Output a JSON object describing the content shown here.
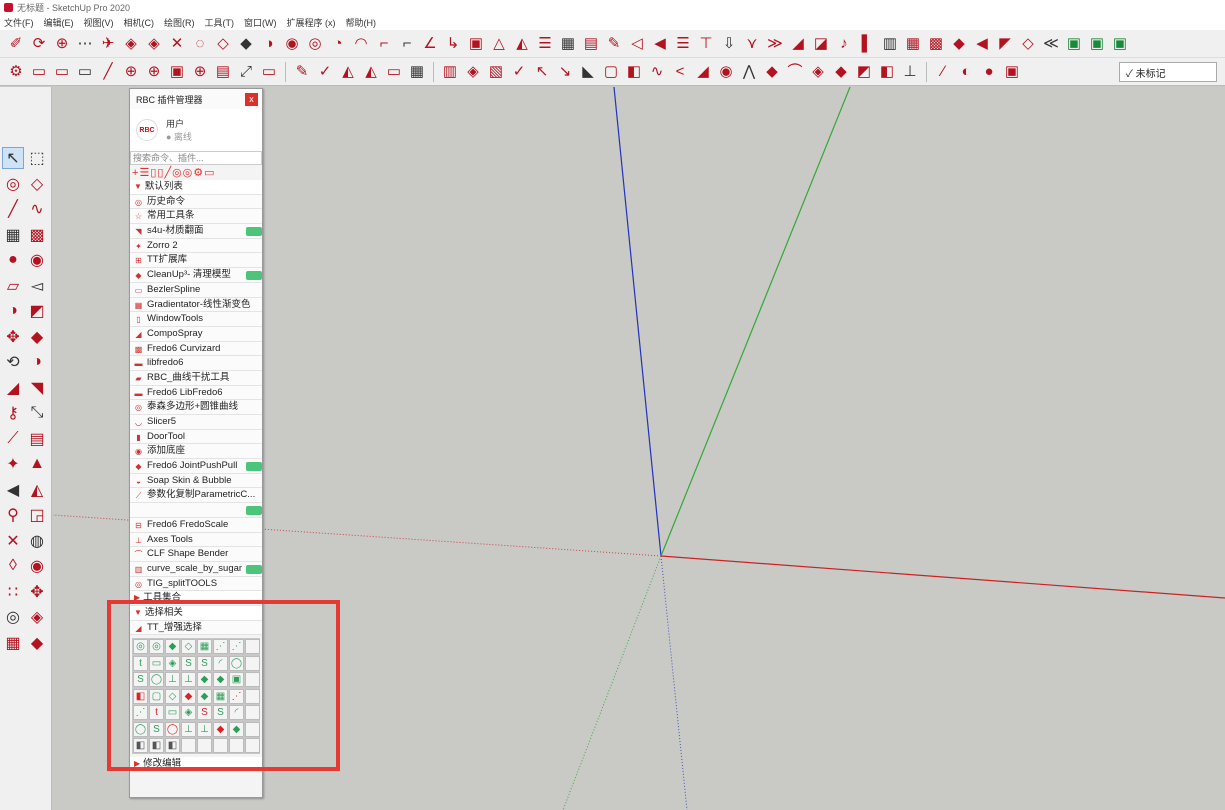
{
  "window": {
    "title": "无标题 - SketchUp Pro 2020"
  },
  "menu": [
    "文件(F)",
    "编辑(E)",
    "视图(V)",
    "相机(C)",
    "绘图(R)",
    "工具(T)",
    "窗口(W)",
    "扩展程序 (x)",
    "帮助(H)"
  ],
  "toolbar1_icons": [
    "✐",
    "⟳",
    "⊕",
    "⋯",
    "✈",
    "◈",
    "◈",
    "✕",
    "◌",
    "◇",
    "◆",
    "◑",
    "◉",
    "◎",
    "◔",
    "◠",
    "⌐",
    "⌐",
    "∠",
    "↳",
    "▣",
    "△",
    "◭",
    "☰",
    "▦",
    "▤",
    "✎",
    "◁",
    "◀",
    "☰",
    "⊤",
    "⇩",
    "⋎",
    "≫",
    "◢",
    "◪",
    "♪",
    "▌",
    "▥",
    "▦",
    "▩",
    "◆",
    "◀",
    "◤",
    "◇",
    "≪",
    "▣",
    "▣",
    "▣"
  ],
  "toolbar2_icons": [
    "⚙",
    "▭",
    "▭",
    "▭",
    "╱",
    "⊕",
    "⊕",
    "▣",
    "⊕",
    "▤",
    "⤢",
    "▭",
    "✎",
    "✓",
    "◭",
    "◭",
    "▭",
    "▦",
    "▥",
    "◈",
    "▧",
    "✓",
    "↖",
    "↘",
    "◣",
    "▢",
    "◧",
    "∿",
    "<",
    "◢",
    "◉",
    "⋀",
    "◆",
    "⌒",
    "◈",
    "◆",
    "◩",
    "◧",
    "⊥",
    "∕",
    "◐",
    "●",
    "▣"
  ],
  "tag": {
    "label": "✓ 未标记"
  },
  "left_toolbar": [
    "↖",
    "⬚",
    "◎",
    "◇",
    "╱",
    "∿",
    "▦",
    "▩",
    "●",
    "◉",
    "▱",
    "◅",
    "◑",
    "◩",
    "✥",
    "◆",
    "⟲",
    "◑",
    "◢",
    "◥",
    "⚷",
    "⤡",
    "⟋",
    "▤",
    "✦",
    "▲",
    "◀",
    "◭",
    "⚲",
    "◲",
    "✕",
    "◍",
    "◊",
    "◉",
    "∷",
    "✥",
    "◎",
    "◈",
    "▦",
    "◆"
  ],
  "panel": {
    "title": "RBC 插件管理器",
    "close": "x",
    "logo": "RBC",
    "user": "用户",
    "status": "● 离线",
    "search_placeholder": "搜索命令、插件...",
    "actions": [
      "+",
      "☰",
      "▯",
      "▯",
      "╱",
      "◎",
      "◎",
      "⚙",
      "▭"
    ],
    "default_list": "默认列表",
    "items": [
      {
        "icon": "◎",
        "label": "历史命令",
        "toggle": false
      },
      {
        "icon": "☆",
        "label": "常用工具条",
        "toggle": false
      },
      {
        "icon": "◥",
        "label": "s4u-材质翻面",
        "toggle": true
      },
      {
        "icon": "✦",
        "label": "Zorro 2",
        "toggle": false
      },
      {
        "icon": "⊞",
        "label": "TT扩展库",
        "toggle": false
      },
      {
        "icon": "◆",
        "label": "CleanUp³- 清理模型",
        "toggle": true
      },
      {
        "icon": "▭",
        "label": "BezlerSpline",
        "toggle": false
      },
      {
        "icon": "▦",
        "label": "Gradientator-线性渐变色",
        "toggle": false
      },
      {
        "icon": "▯",
        "label": "WindowTools",
        "toggle": false
      },
      {
        "icon": "◢",
        "label": "CompoSpray",
        "toggle": false
      },
      {
        "icon": "▩",
        "label": "Fredo6 Curvizard",
        "toggle": false
      },
      {
        "icon": "▬",
        "label": "libfredo6",
        "toggle": false
      },
      {
        "icon": "▰",
        "label": "RBC_曲线干扰工具",
        "toggle": false
      },
      {
        "icon": "▬",
        "label": "Fredo6 LibFredo6",
        "toggle": false
      },
      {
        "icon": "◎",
        "label": "泰森多边形+圆锥曲线",
        "toggle": false
      },
      {
        "icon": "◡",
        "label": "Slicer5",
        "toggle": false
      },
      {
        "icon": "▮",
        "label": "DoorTool",
        "toggle": false
      },
      {
        "icon": "◉",
        "label": "添加底座",
        "toggle": false
      },
      {
        "icon": "◆",
        "label": "Fredo6 JointPushPull",
        "toggle": true
      },
      {
        "icon": "◒",
        "label": "Soap Skin & Bubble",
        "toggle": false
      },
      {
        "icon": "⟋",
        "label": "参数化复制ParametricC...",
        "toggle": false
      },
      {
        "icon": "",
        "label": "",
        "toggle": true
      },
      {
        "icon": "⊟",
        "label": "Fredo6 FredoScale",
        "toggle": false
      },
      {
        "icon": "⊥",
        "label": "Axes Tools",
        "toggle": false
      },
      {
        "icon": "⌒",
        "label": "CLF Shape Bender",
        "toggle": false
      },
      {
        "icon": "▥",
        "label": "curve_scale_by_sugar",
        "toggle": true
      },
      {
        "icon": "◎",
        "label": "TIG_splitTOOLS",
        "toggle": false
      }
    ],
    "groups": [
      "工具集合",
      "选择相关"
    ],
    "tt_item": "TT_增强选择",
    "grid_icons": [
      "◎",
      "◎",
      "◆",
      "◇",
      "▦",
      "⋰",
      "⋰",
      "",
      "t",
      "▭",
      "◈",
      "S",
      "S",
      "◜",
      "◯",
      "",
      "S",
      "◯",
      "⊥",
      "⊥",
      "◆",
      "◆",
      "▣",
      "",
      "◧",
      "▢",
      "◇",
      "◆",
      "◆",
      "▦",
      "⋰",
      "",
      "⋰",
      "t",
      "▭",
      "◈",
      "S",
      "S",
      "◜",
      "",
      "◯",
      "S",
      "◯",
      "⊥",
      "⊥",
      "◆",
      "◆",
      "",
      "◧",
      "◧",
      "◧",
      "",
      "",
      "",
      "",
      ""
    ],
    "last_group": "修改编辑"
  }
}
